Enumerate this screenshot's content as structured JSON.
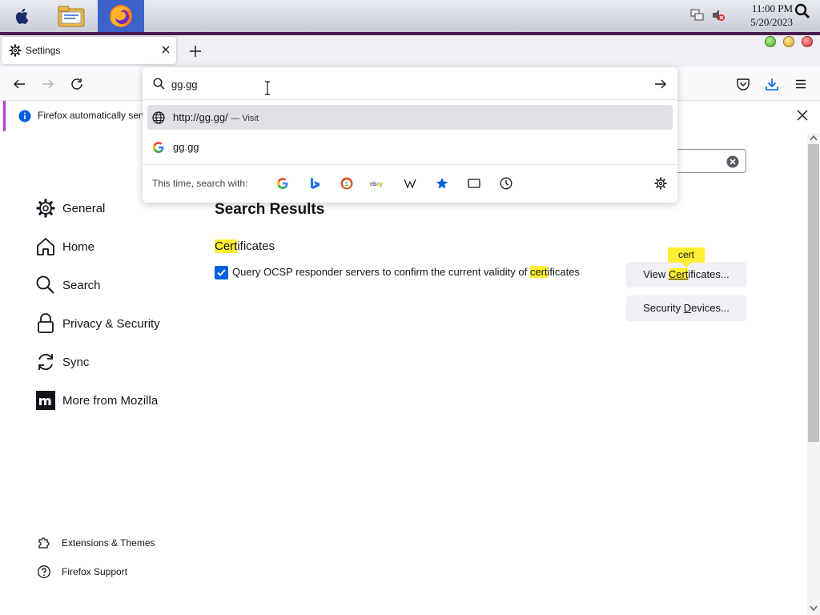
{
  "os": {
    "clock_time": "11:00 PM",
    "clock_date": "5/20/2023"
  },
  "tab": {
    "title": "Settings"
  },
  "urlbar": {
    "value": "gg.gg",
    "suggestions": {
      "visit_url": "http://gg.gg/",
      "visit_suffix": "— Visit",
      "search_text": "gg.gg"
    },
    "one_off_label": "This time, search with:",
    "engines": [
      "google-icon",
      "bing-icon",
      "duckduckgo-icon",
      "ebay-icon",
      "wikipedia-icon",
      "bookmarks-icon",
      "tabs-icon",
      "history-icon"
    ]
  },
  "notification": {
    "message": "Firefox automatically send"
  },
  "sidebar": {
    "items": [
      {
        "label": "General",
        "icon": "gear-icon"
      },
      {
        "label": "Home",
        "icon": "home-icon"
      },
      {
        "label": "Search",
        "icon": "search-icon"
      },
      {
        "label": "Privacy & Security",
        "icon": "lock-icon"
      },
      {
        "label": "Sync",
        "icon": "sync-icon"
      },
      {
        "label": "More from Mozilla",
        "icon": "mozilla-icon"
      }
    ],
    "footer": [
      {
        "label": "Extensions & Themes",
        "icon": "puzzle-icon"
      },
      {
        "label": "Firefox Support",
        "icon": "help-icon"
      }
    ]
  },
  "main": {
    "results_title": "Search Results",
    "section_heading_hl": "Cert",
    "section_heading_rest": "ificates",
    "ocsp_pre": "Query OCSP responder servers to confirm the current validity of ",
    "ocsp_hl": "cert",
    "ocsp_post": "ificates",
    "ocsp_checked": true,
    "view_certs_pre": "View ",
    "view_certs_hl": "Cert",
    "view_certs_post": "ificates...",
    "sec_devices_pre": "Security ",
    "sec_devices_u": "D",
    "sec_devices_post": "evices...",
    "tooltip": "cert"
  },
  "colors": {
    "accent": "#0060df",
    "highlight": "#ffee32"
  }
}
